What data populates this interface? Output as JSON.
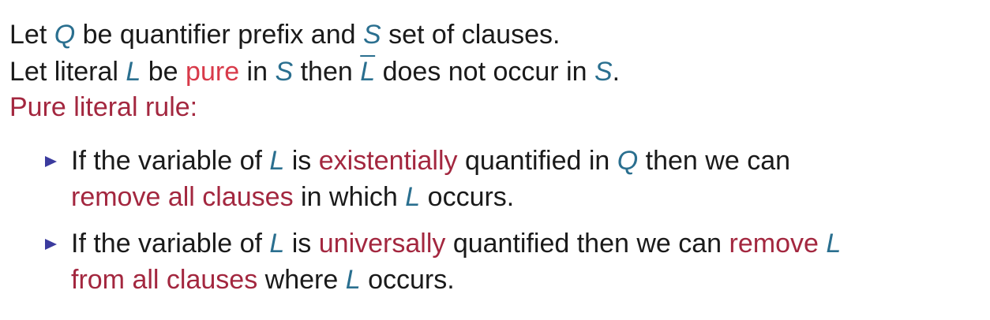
{
  "line1": {
    "t1": "Let ",
    "q": "Q",
    "t2": " be quantifier prefix and ",
    "s": "S",
    "t3": " set of clauses."
  },
  "line2": {
    "t1": "Let literal ",
    "l": "L",
    "t2": " be ",
    "pure": "pure",
    "t3": " in ",
    "s": "S",
    "t4": " then ",
    "lbar": "L",
    "t5": " does not occur in ",
    "s2": "S",
    "t6": "."
  },
  "rule_heading": "Pure literal rule:",
  "bullets": [
    {
      "t1": "If the variable of ",
      "l": "L",
      "t2": " is ",
      "kw": "existentially",
      "t3": " quantified in ",
      "q": "Q",
      "t4": " then we can",
      "kw2": "remove all clauses",
      "t5": " in which ",
      "l2": "L",
      "t6": " occurs."
    },
    {
      "t1": "If the variable of ",
      "l": "L",
      "t2": " is ",
      "kw": "universally",
      "t3": " quantified then we can ",
      "kw2": "remove",
      "t4": " ",
      "l2": "L",
      "kw3": "from all clauses",
      "t5": " where ",
      "l3": "L",
      "t6": " occurs."
    }
  ],
  "colors": {
    "math": "#2a6f8f",
    "highlight": "#d83a4a",
    "emphasis": "#a3273f",
    "bullet": "#3b3b9e"
  },
  "icons": {
    "bullet": "triangle-right-icon"
  }
}
